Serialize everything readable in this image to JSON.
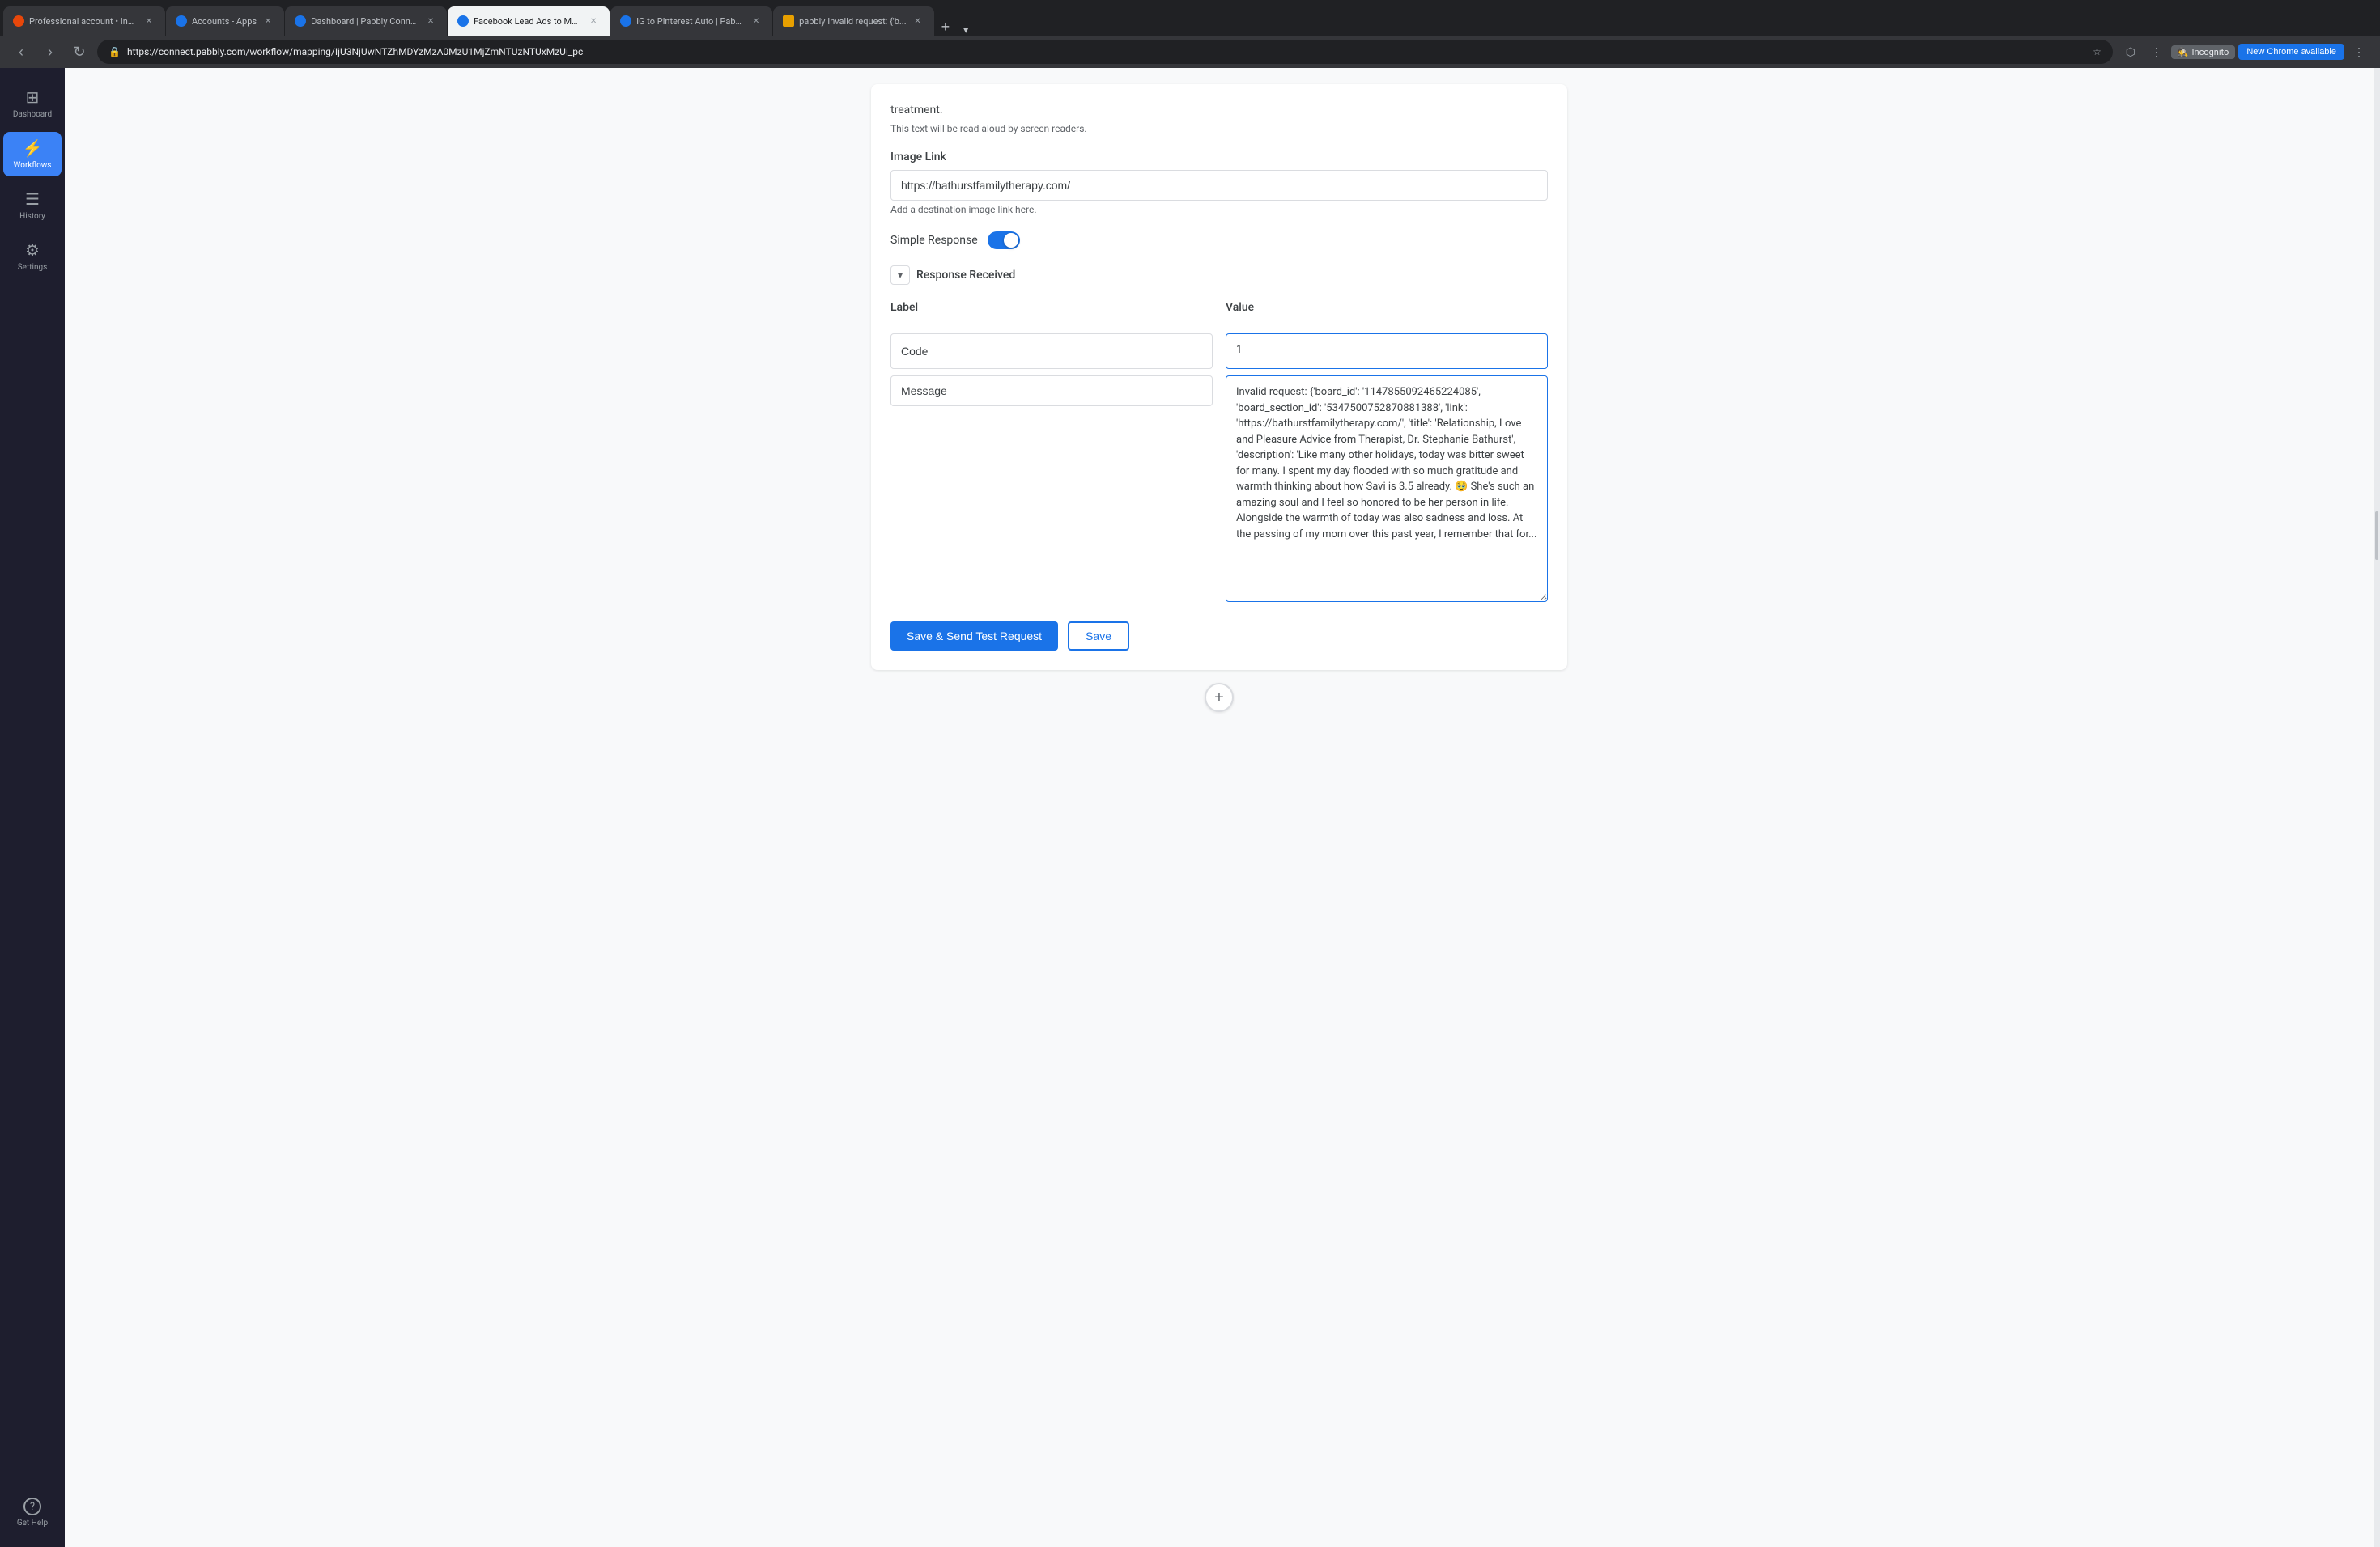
{
  "browser": {
    "tabs": [
      {
        "id": "tab1",
        "favicon_color": "#e8470a",
        "label": "Professional account • Ins...",
        "active": false
      },
      {
        "id": "tab2",
        "favicon_color": "#1a73e8",
        "label": "Accounts - Apps",
        "active": false
      },
      {
        "id": "tab3",
        "favicon_color": "#1a73e8",
        "label": "Dashboard | Pabbly Conne...",
        "active": false
      },
      {
        "id": "tab4",
        "favicon_color": "#1a73e8",
        "label": "Facebook Lead Ads to Ma...",
        "active": true
      },
      {
        "id": "tab5",
        "favicon_color": "#1a73e8",
        "label": "IG to Pinterest Auto | Pabb...",
        "active": false
      },
      {
        "id": "tab6",
        "favicon_color": "#e8a000",
        "label": "pabbly Invalid request: {'b...",
        "active": false
      }
    ],
    "url": "https://connect.pabbly.com/workflow/mapping/IjU3NjUwNTZhMDYzMzA0MzU1MjZmNTUzNTUxMzUi_pc",
    "incognito_label": "Incognito",
    "new_chrome_label": "New Chrome available"
  },
  "sidebar": {
    "items": [
      {
        "id": "dashboard",
        "label": "Dashboard",
        "icon": "⊞",
        "active": false
      },
      {
        "id": "workflows",
        "label": "Workflows",
        "icon": "⚡",
        "active": true
      },
      {
        "id": "history",
        "label": "History",
        "icon": "☰",
        "active": false
      },
      {
        "id": "settings",
        "label": "Settings",
        "icon": "⚙",
        "active": false
      },
      {
        "id": "get-help",
        "label": "Get Help",
        "icon": "?",
        "active": false
      }
    ]
  },
  "form": {
    "truncated_text": "treatment.",
    "screen_reader_helper": "This text will be read aloud by screen readers.",
    "image_link_label": "Image Link",
    "image_link_value": "https://bathurstfamilytherapy.com/",
    "image_link_helper": "Add a destination image link here.",
    "simple_response_label": "Simple Response",
    "simple_response_enabled": true,
    "response_received_label": "Response Received",
    "label_column": "Label",
    "value_column": "Value",
    "code_label": "Code",
    "code_value": "1",
    "message_label": "Message",
    "message_value": "Invalid request: {'board_id': '1147855092465224085', 'board_section_id': '5347500752870881388', 'link': 'https://bathurstfamilytherapy.com/', 'title': 'Relationship, Love and Pleasure Advice from Therapist, Dr. Stephanie Bathurst', 'description': 'Like many other holidays, today was bitter sweet for many. I spent my day flooded with so much gratitude and warmth thinking about how Savi is 3.5 already. 🥹 She's such an amazing soul and I feel so honored to be her person in life. Alongside the warmth of today was also sadness and loss. At the passing of my mom over this past year, I remember that for...",
    "save_test_label": "Save & Send Test Request",
    "save_label": "Save"
  }
}
